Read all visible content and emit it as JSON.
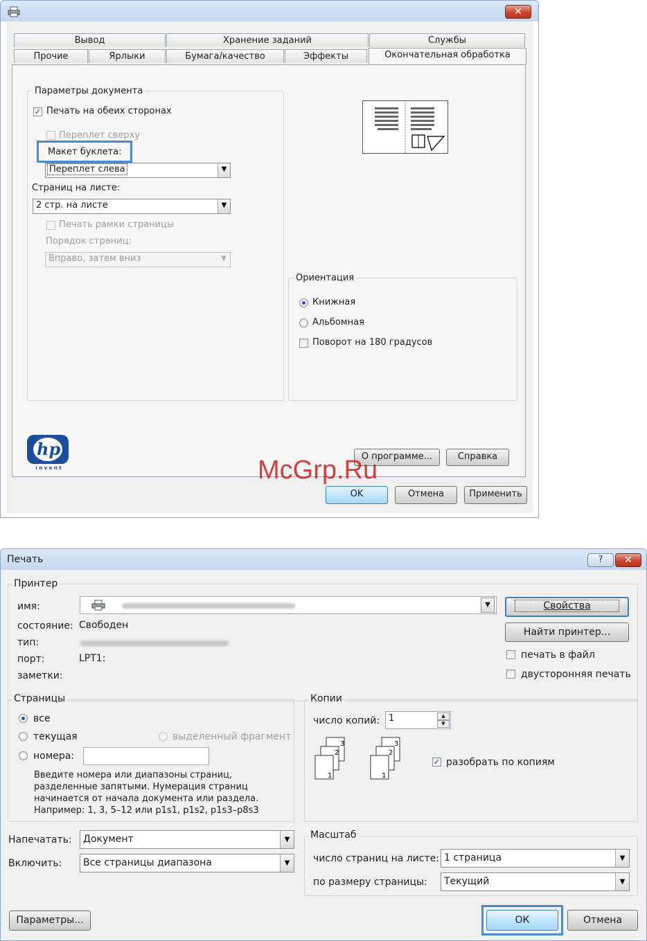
{
  "top_window": {
    "tabs_row1": [
      "Вывод",
      "Хранение заданий",
      "Службы"
    ],
    "tabs_row2": [
      "Прочие",
      "Ярлыки",
      "Бумага/качество",
      "Эффекты",
      "Окончательная обработка"
    ],
    "doc_group_label": "Параметры документа",
    "duplex_label": "Печать на обеих сторонах",
    "bind_top_label": "Переплет сверху",
    "booklet_label": "Макет буклета:",
    "booklet_value": "Переплет слева",
    "pages_per_sheet_label": "Страниц на листе:",
    "pages_per_sheet_value": "2 стр. на листе",
    "print_borders_label": "Печать рамки страницы",
    "page_order_label": "Порядок страниц:",
    "page_order_value": "Вправо, затем вниз",
    "orientation_label": "Ориентация",
    "portrait_label": "Книжная",
    "landscape_label": "Альбомная",
    "rotate_label": "Поворот на 180 градусов",
    "logo_tagline": "i n v e n t",
    "about_button": "О программе...",
    "help_button": "Справка",
    "ok_button": "OK",
    "cancel_button": "Отмена",
    "apply_button": "Применить"
  },
  "watermark": "McGrp.Ru",
  "print_dialog": {
    "title": "Печать",
    "help_button": "?",
    "printer_group": "Принтер",
    "name_label": "имя:",
    "status_label": "состояние:",
    "status_value": "Свободен",
    "type_label": "тип:",
    "port_label": "порт:",
    "port_value": "LPT1:",
    "notes_label": "заметки:",
    "properties_button": "Свойства",
    "find_printer_button": "Найти принтер...",
    "print_to_file": "печать в файл",
    "duplex": "двусторонняя печать",
    "pages_group": "Страницы",
    "all_label": "все",
    "current_label": "текущая",
    "selection_label": "выделенный фрагмент",
    "numbers_label": "номера:",
    "help_text": [
      "Введите номера или диапазоны страниц,",
      "разделенные запятыми. Нумерация страниц",
      "начинается от начала документа или раздела.",
      "Например: 1, 3, 5–12 или p1s1, p1s2, p1s3–p8s3"
    ],
    "copies_group": "Копии",
    "copies_label": "число копий:",
    "copies_value": "1",
    "collate_label": "разобрать по копиям",
    "collate_icon_numbers": [
      "1",
      "2",
      "3"
    ],
    "print_what_label": "Напечатать:",
    "print_what_value": "Документ",
    "include_label": "Включить:",
    "include_value": "Все страницы диапазона",
    "zoom_group": "Масштаб",
    "pages_per_sheet_label": "число страниц на листе:",
    "pages_per_sheet_value": "1 страница",
    "scale_to_label": "по размеру страницы:",
    "scale_to_value": "Текущий",
    "options_button": "Параметры...",
    "ok_button": "ОК",
    "cancel_button": "Отмена"
  }
}
